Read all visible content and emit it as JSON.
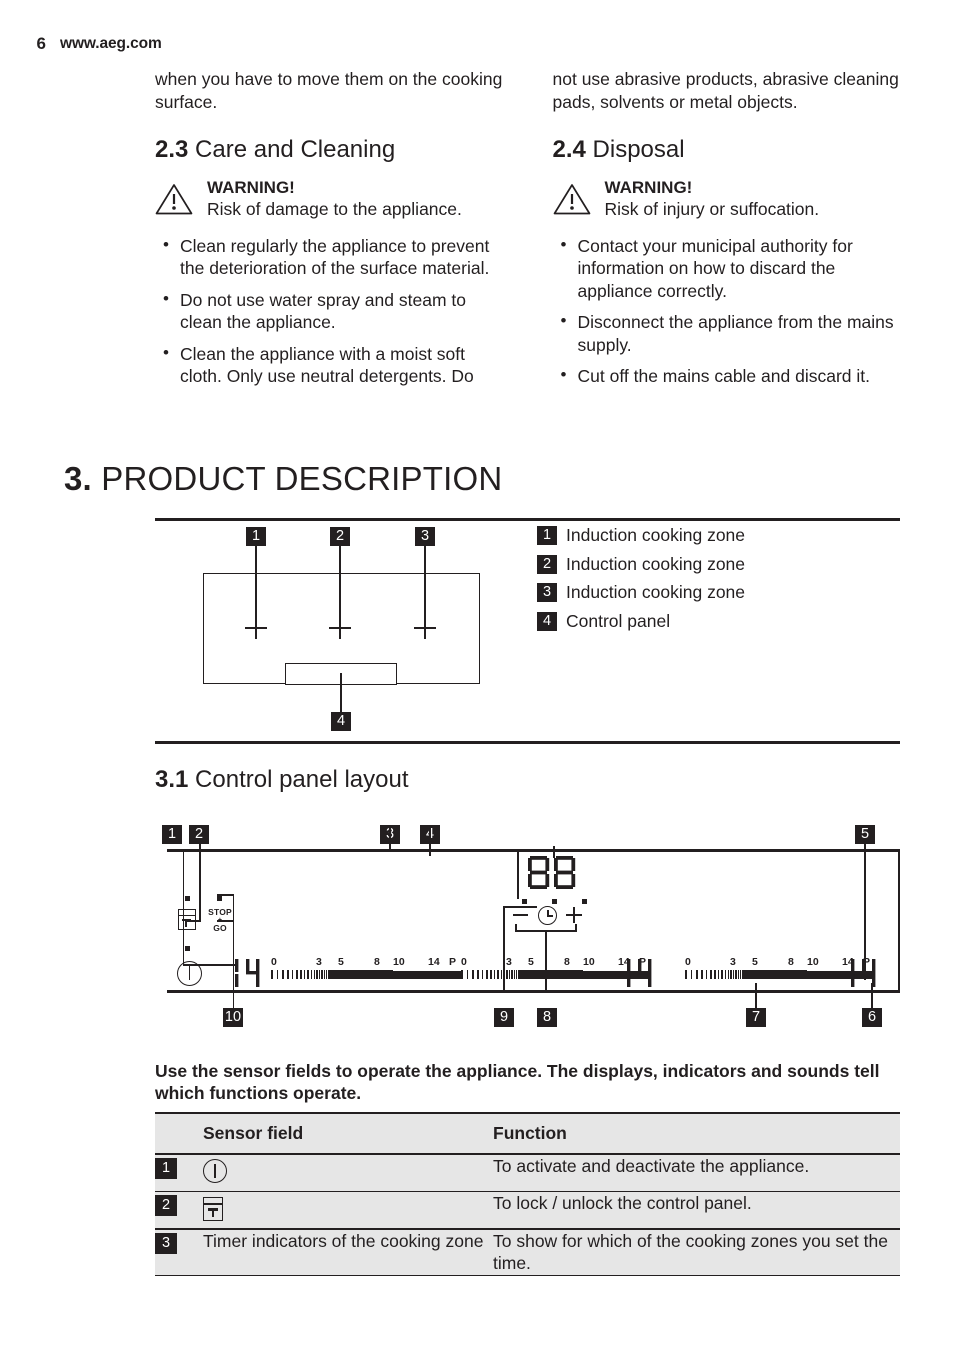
{
  "header": {
    "page_number": "6",
    "site": "www.aeg.com"
  },
  "left_column": {
    "continued_text": "when you have to move them on the cooking surface.",
    "section": {
      "number": "2.3",
      "title": "Care and Cleaning"
    },
    "warning": {
      "title": "WARNING!",
      "text": "Risk of damage to the appliance."
    },
    "bullets": [
      "Clean regularly the appliance to prevent the deterioration of the surface material.",
      "Do not use water spray and steam to clean the appliance.",
      "Clean the appliance with a moist soft cloth. Only use neutral detergents. Do"
    ]
  },
  "right_column": {
    "continued_text": "not use abrasive products, abrasive cleaning pads, solvents or metal objects.",
    "section": {
      "number": "2.4",
      "title": "Disposal"
    },
    "warning": {
      "title": "WARNING!",
      "text": "Risk of injury or suffocation."
    },
    "bullets": [
      "Contact your municipal authority for information on how to discard the appliance correctly.",
      "Disconnect the appliance from the mains supply.",
      "Cut off the mains cable and discard it."
    ]
  },
  "chapter": {
    "number": "3.",
    "title": "PRODUCT DESCRIPTION"
  },
  "product_figure": {
    "callouts": [
      "1",
      "2",
      "3",
      "4"
    ],
    "legend": [
      {
        "num": "1",
        "label": "Induction cooking zone"
      },
      {
        "num": "2",
        "label": "Induction cooking zone"
      },
      {
        "num": "3",
        "label": "Induction cooking zone"
      },
      {
        "num": "4",
        "label": "Control panel"
      }
    ]
  },
  "control_panel_section": {
    "number": "3.1",
    "title": "Control panel layout",
    "callouts": [
      "1",
      "2",
      "3",
      "4",
      "5",
      "6",
      "7",
      "8",
      "9",
      "10"
    ],
    "stop_go_label_top": "STOP",
    "stop_go_label_bottom": "GO",
    "timer_display": "88",
    "heat_level_displays": [
      "14",
      "14",
      "14"
    ],
    "scale_ticks": [
      "0",
      "3",
      "5",
      "8",
      "10",
      "14",
      "P"
    ]
  },
  "intro_text": "Use the sensor fields to operate the appliance. The displays, indicators and sounds tell which functions operate.",
  "table": {
    "headers": [
      "",
      "Sensor field",
      "Function"
    ],
    "rows": [
      {
        "num": "1",
        "sensor": "",
        "sensor_icon": "power-icon",
        "function": "To activate and deactivate the appliance."
      },
      {
        "num": "2",
        "sensor": "",
        "sensor_icon": "lock-icon",
        "function": "To lock / unlock the control panel."
      },
      {
        "num": "3",
        "sensor": "Timer indicators of the cooking zone",
        "sensor_icon": "",
        "function": "To show for which of the cooking zones you set the time."
      }
    ]
  },
  "colors": {
    "ink": "#231f20",
    "row_bg": "#e6e6e6",
    "page_bg": "#ffffff"
  }
}
